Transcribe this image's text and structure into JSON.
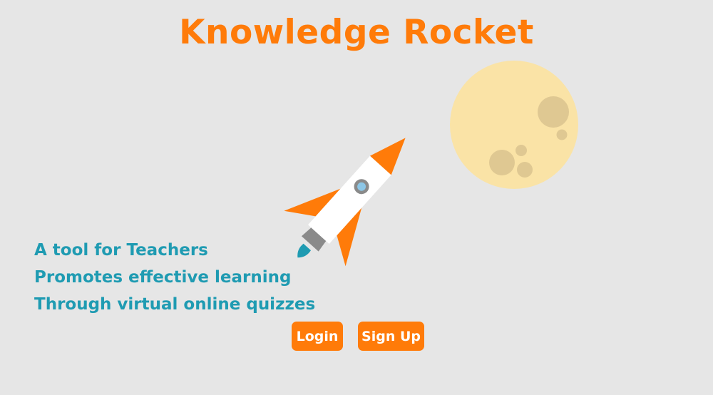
{
  "header": {
    "title": "Knowledge Rocket"
  },
  "taglines": [
    "A tool for Teachers",
    "Promotes effective learning",
    "Through virtual online quizzes"
  ],
  "actions": {
    "login_label": "Login",
    "signup_label": "Sign Up"
  },
  "illustration": {
    "icons": [
      "rocket-icon",
      "moon-icon"
    ]
  },
  "colors": {
    "background": "#e6e6e6",
    "accent": "#ff7b09",
    "tagline": "#1f9bb2",
    "moon": "#fae3a6",
    "crater": "#dfc892"
  }
}
